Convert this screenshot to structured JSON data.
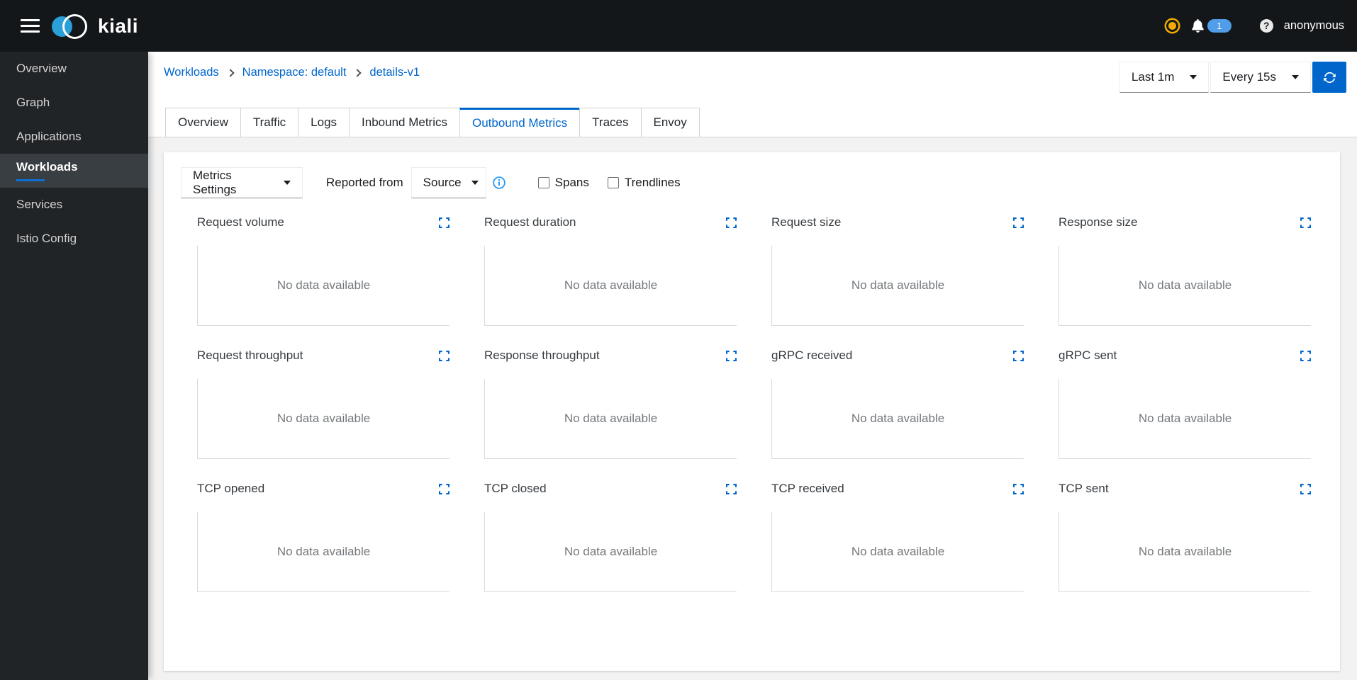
{
  "masthead": {
    "brand": "kiali",
    "user": "anonymous",
    "notification_badge": "1"
  },
  "sidebar": {
    "items": [
      {
        "label": "Overview"
      },
      {
        "label": "Graph"
      },
      {
        "label": "Applications"
      },
      {
        "label": "Workloads"
      },
      {
        "label": "Services"
      },
      {
        "label": "Istio Config"
      }
    ],
    "active_item": "Workloads"
  },
  "breadcrumb": {
    "items": [
      {
        "label": "Workloads"
      },
      {
        "label": "Namespace: default"
      },
      {
        "label": "details-v1"
      }
    ]
  },
  "time_toolbar": {
    "duration": "Last 1m",
    "refresh_interval": "Every 15s"
  },
  "tabs": {
    "items": [
      {
        "label": "Overview"
      },
      {
        "label": "Traffic"
      },
      {
        "label": "Logs"
      },
      {
        "label": "Inbound Metrics"
      },
      {
        "label": "Outbound Metrics"
      },
      {
        "label": "Traces"
      },
      {
        "label": "Envoy"
      }
    ],
    "active_tab": "Outbound Metrics"
  },
  "metrics_toolbar": {
    "settings": "Metrics Settings",
    "reported_from": "Reported from",
    "reporter": "Source",
    "spans": "Spans",
    "trendlines": "Trendlines"
  },
  "charts": {
    "empty_message": "No data available",
    "items": [
      {
        "title": "Request volume"
      },
      {
        "title": "Request duration"
      },
      {
        "title": "Request size"
      },
      {
        "title": "Response size"
      },
      {
        "title": "Request throughput"
      },
      {
        "title": "Response throughput"
      },
      {
        "title": "gRPC received"
      },
      {
        "title": "gRPC sent"
      },
      {
        "title": "TCP opened"
      },
      {
        "title": "TCP closed"
      },
      {
        "title": "TCP received"
      },
      {
        "title": "TCP sent"
      }
    ]
  },
  "icons": {
    "menu": "hamburger",
    "brand": "kiali-overlapping-rings",
    "mesh_status": "amber-ring-dot",
    "notifications": "bell",
    "help": "question-circle",
    "breadcrumb_separator": "angle-right",
    "dropdown": "caret-down",
    "refresh": "sync-arrows",
    "info": "info-circle",
    "chart_expand": "expand-corners"
  },
  "colors": {
    "accent": "#0066cc",
    "masthead_bg": "#14171a",
    "sidebar_bg": "#212427",
    "active_nav_bg": "#393e43",
    "warning": "#f0ab00",
    "badge_bg": "#519de9",
    "info_blue": "#2b9af3",
    "muted_text": "#74787c",
    "page_bg": "#f2f2f2"
  }
}
